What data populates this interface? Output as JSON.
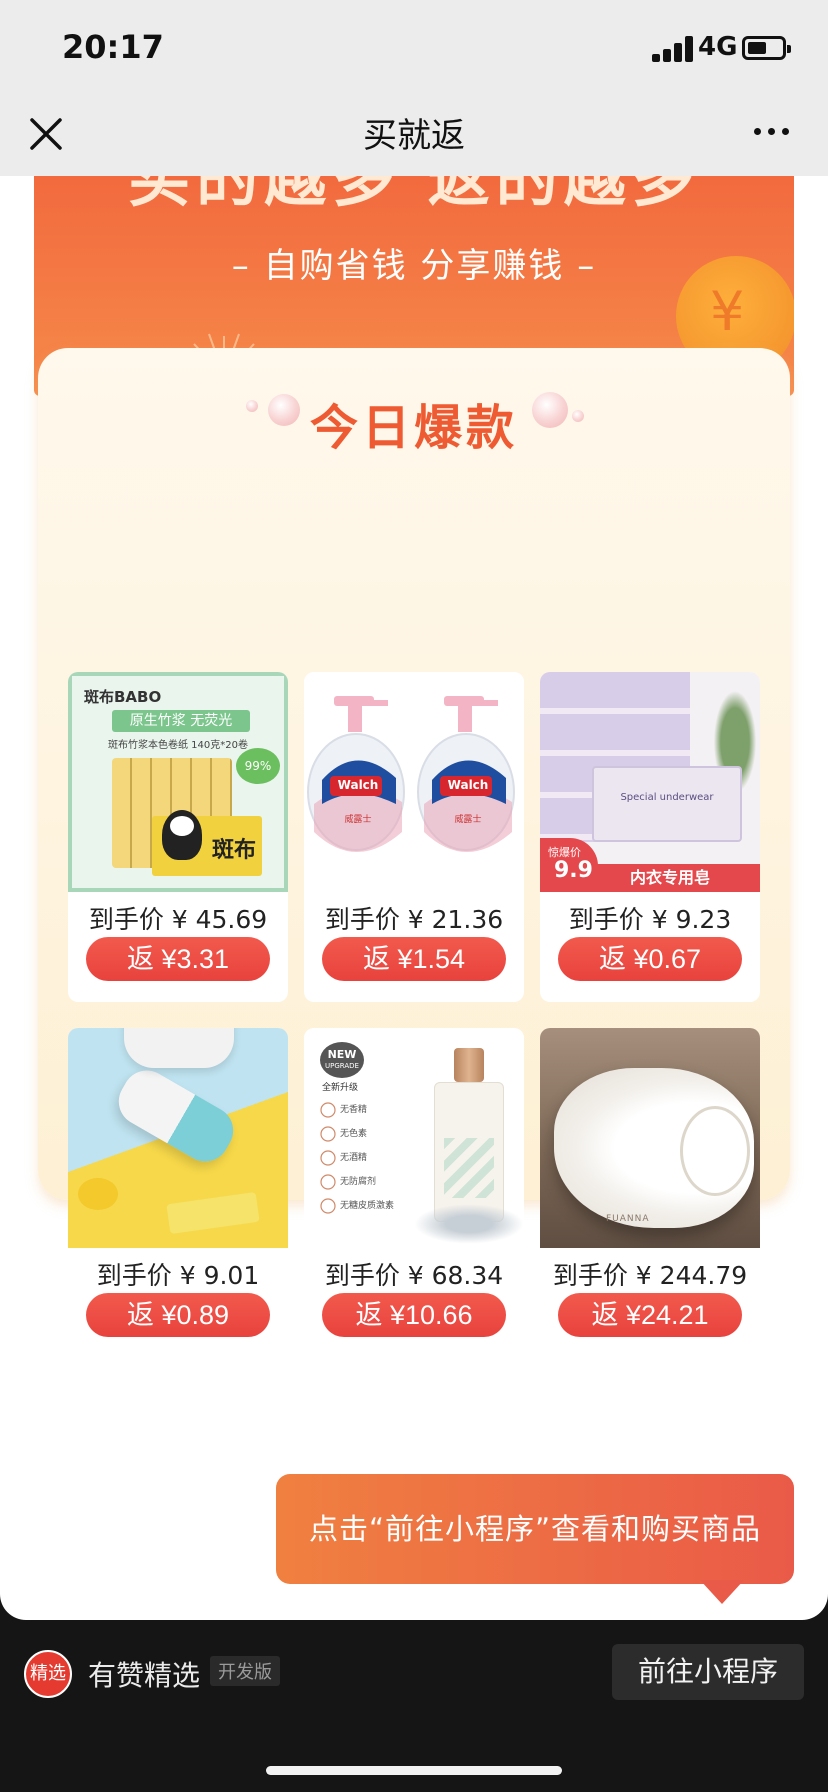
{
  "status_bar": {
    "time": "20:17",
    "network": "4G"
  },
  "nav": {
    "title": "买就返"
  },
  "hero": {
    "headline": "买的越多 返的越多",
    "subline": "– 自购省钱 分享赚钱 –",
    "coin_symbol": "¥"
  },
  "panel": {
    "title": "今日爆款"
  },
  "products": [
    {
      "price": "到手价 ¥ 45.69",
      "rebate": "返 ¥3.31"
    },
    {
      "price": "到手价 ¥ 21.36",
      "rebate": "返 ¥1.54"
    },
    {
      "price": "到手价 ¥ 9.23",
      "rebate": "返 ¥0.67"
    },
    {
      "price": "到手价 ¥ 9.01",
      "rebate": "返 ¥0.89"
    },
    {
      "price": "到手价 ¥ 68.34",
      "rebate": "返 ¥10.66"
    },
    {
      "price": "到手价 ¥ 244.79",
      "rebate": "返 ¥24.21"
    }
  ],
  "product_art": {
    "p1": {
      "brand": "斑布BABO",
      "tagline": "原生竹浆 无荧光",
      "desc": "斑布竹浆本色卷纸 140克*20卷",
      "badge": "99%",
      "box_text": "斑布"
    },
    "p2": {
      "brand": "Walch",
      "label": "威露士"
    },
    "p3": {
      "badge_top": "惊爆价",
      "badge_price": "9.9",
      "banner": "内衣专用皂",
      "pack_text": "Special underwear"
    },
    "p5": {
      "new": "NEW",
      "upgrade": "UPGRADE",
      "upgrade_cn": "全新升级",
      "features": [
        "无香精",
        "无色素",
        "无酒精",
        "无防腐剂",
        "无糖皮质激素"
      ]
    },
    "p6": {
      "brand": "FUANNA"
    }
  },
  "tooltip": {
    "text": "点击“前往小程序”查看和购买商品"
  },
  "bottom": {
    "logo_text": "精选",
    "app_name": "有赞精选",
    "dev_tag": "开发版",
    "go_button": "前往小程序"
  },
  "colors": {
    "accent": "#ee5a32",
    "rebate": "#e8423d",
    "hero": "#f26a3e",
    "panel": "#fff8ec"
  }
}
